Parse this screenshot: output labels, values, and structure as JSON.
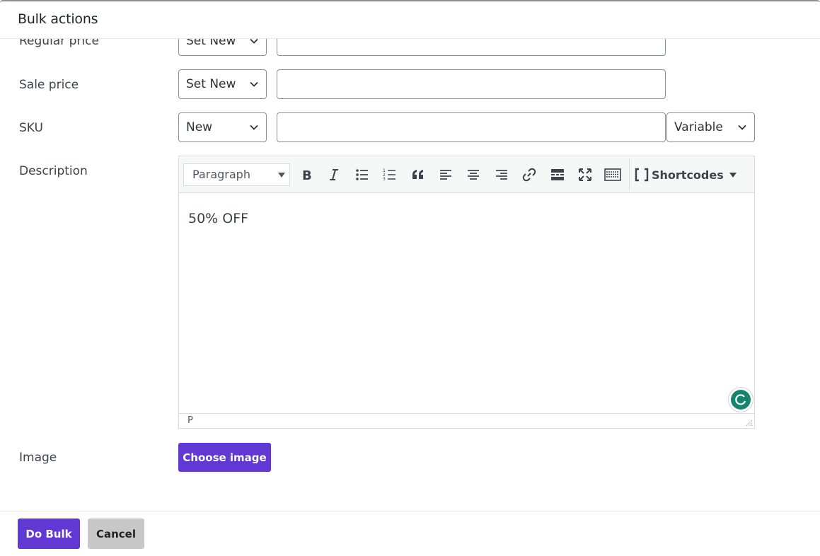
{
  "header": {
    "title": "Bulk actions"
  },
  "rows": {
    "regular_price": {
      "label": "Regular price",
      "mode": "Set New",
      "value": ""
    },
    "sale_price": {
      "label": "Sale price",
      "mode": "Set New",
      "value": ""
    },
    "sku": {
      "label": "SKU",
      "mode": "New",
      "value": "",
      "type": "Variable"
    },
    "description": {
      "label": "Description"
    },
    "image": {
      "label": "Image",
      "button_label": "Choose image"
    }
  },
  "editor": {
    "format": "Paragraph",
    "toolbar_icons": [
      "bold-icon",
      "italic-icon",
      "bulleted-list-icon",
      "numbered-list-icon",
      "blockquote-icon",
      "align-left-icon",
      "align-center-icon",
      "align-right-icon",
      "link-icon",
      "read-more-icon",
      "fullscreen-icon",
      "keyboard-toolbar-icon"
    ],
    "shortcodes_label": "Shortcodes",
    "content": "50% OFF",
    "path": "P"
  },
  "footer": {
    "do_bulk_label": "Do Bulk",
    "cancel_label": "Cancel"
  },
  "colors": {
    "primary": "#6238d4",
    "secondary": "#c8c8c8",
    "grammarly": "#15846e"
  }
}
